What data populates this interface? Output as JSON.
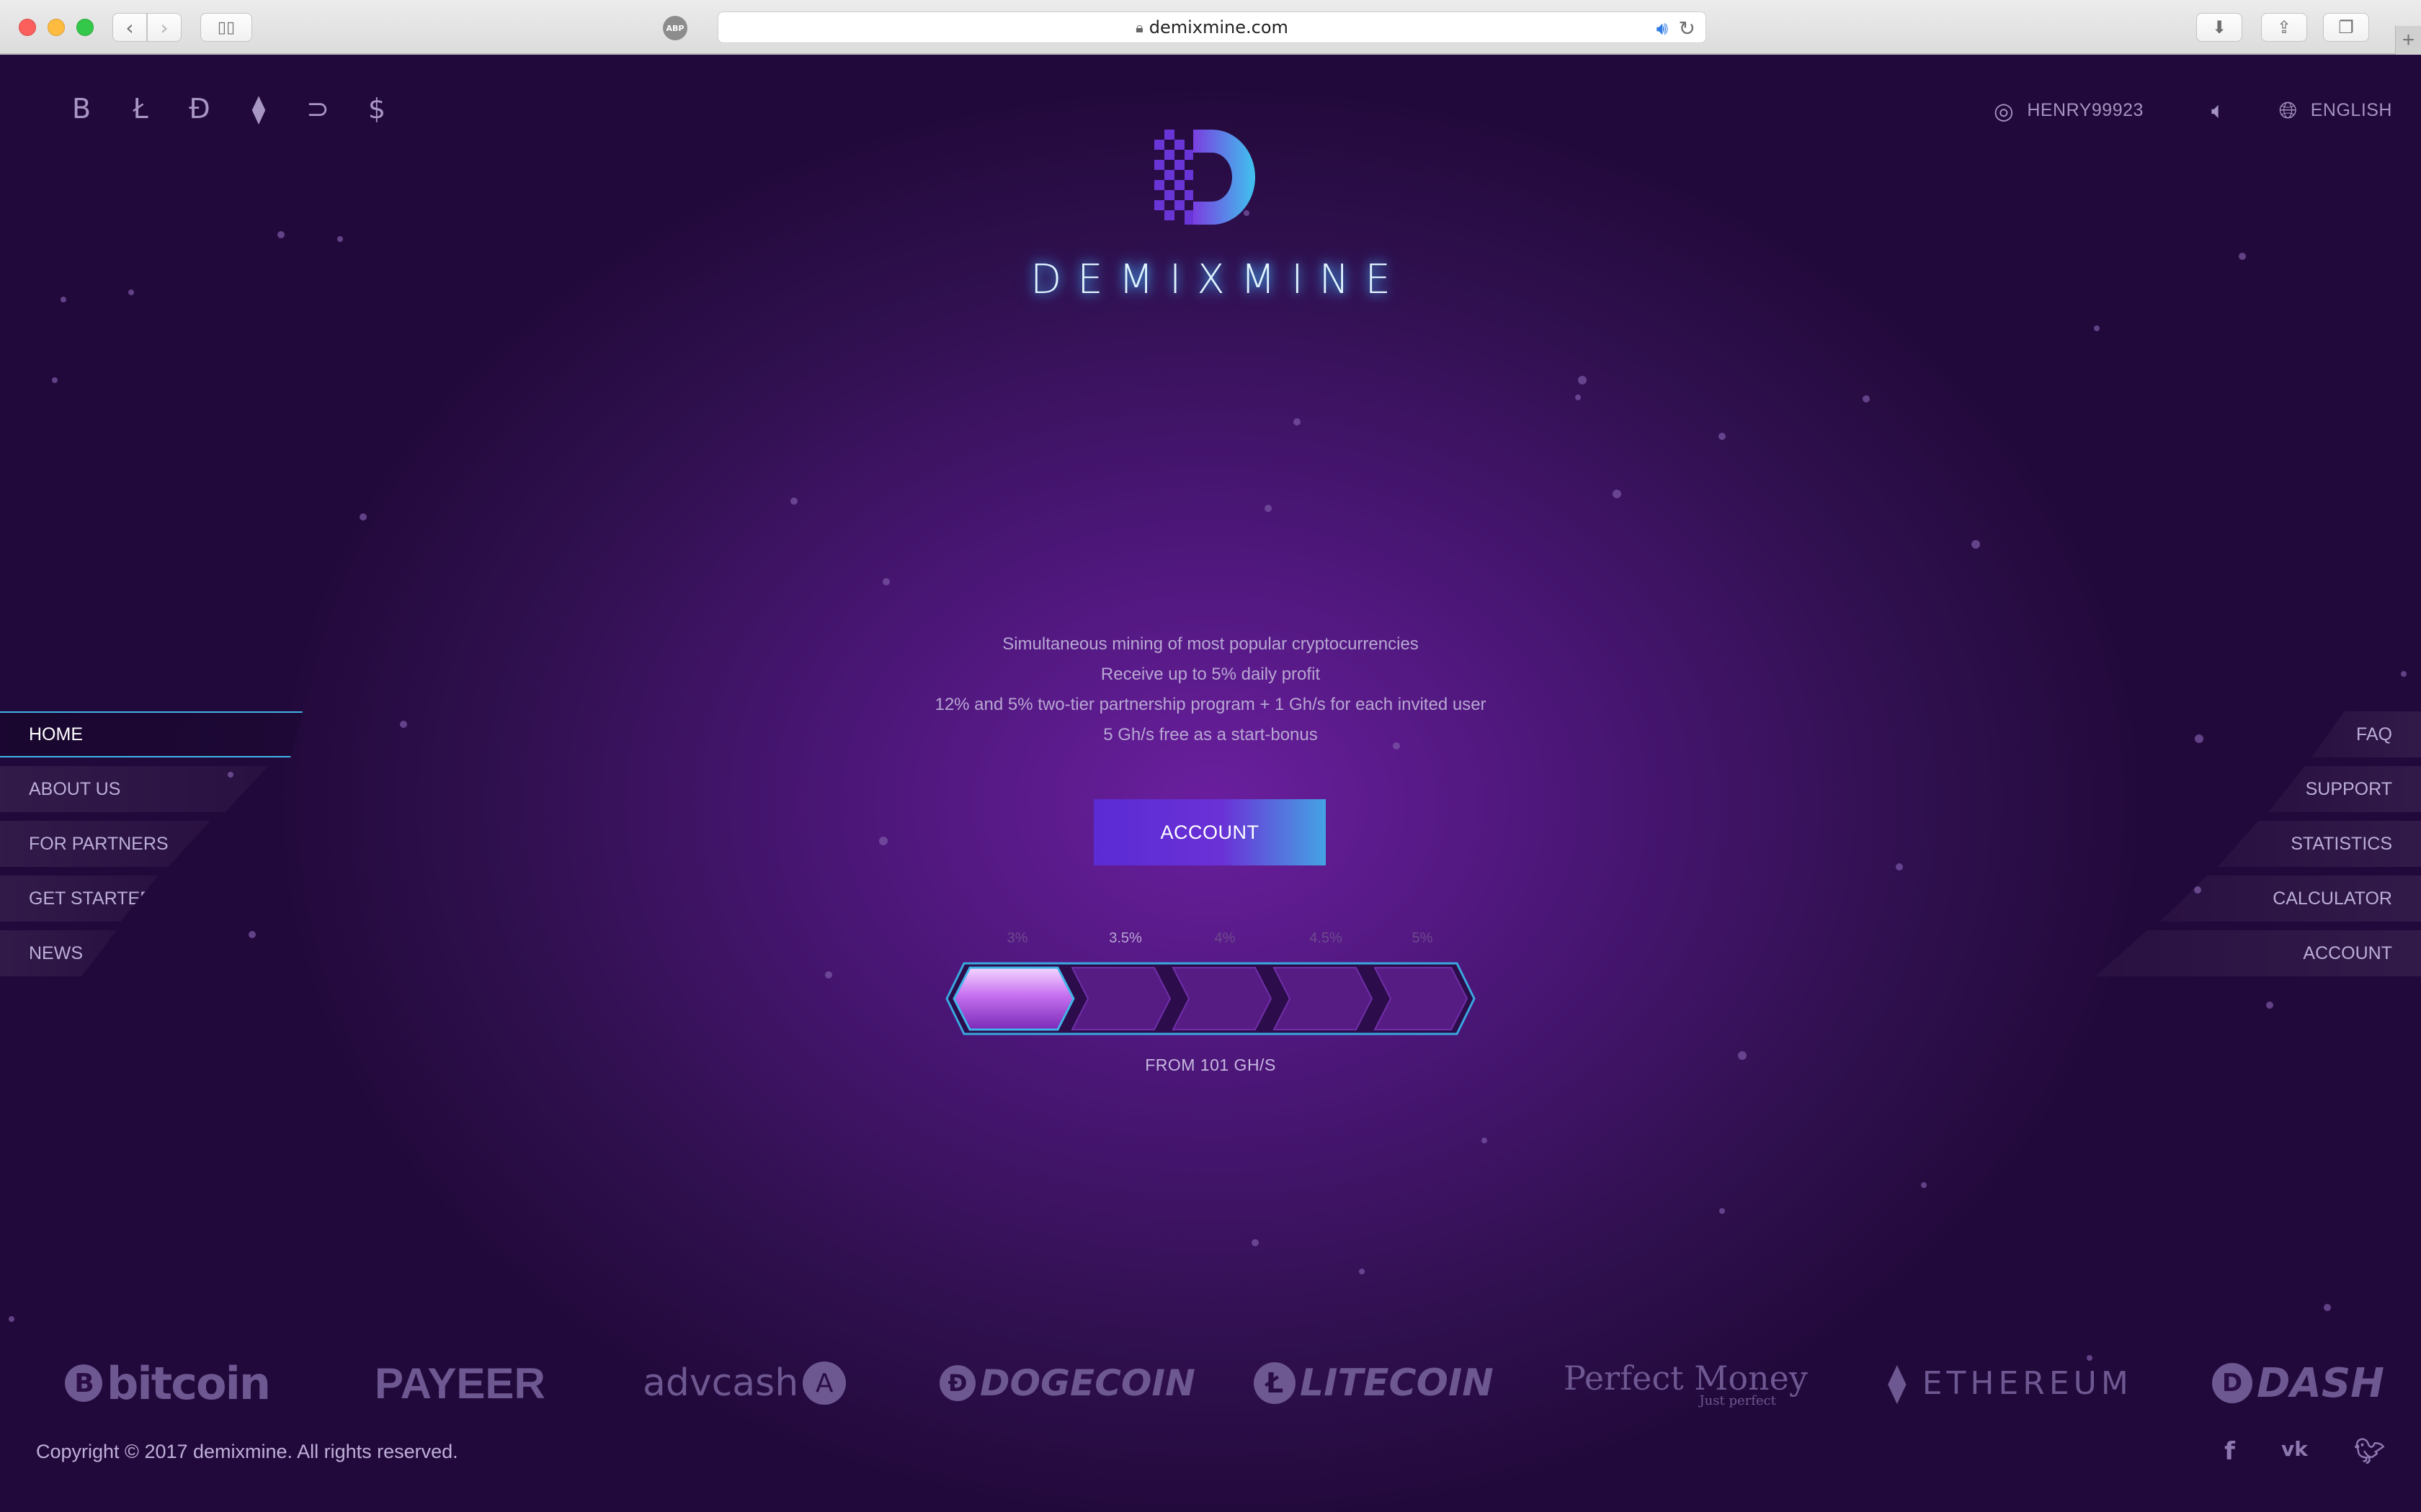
{
  "browser": {
    "url": "demixmine.com",
    "abp_label": "ABP"
  },
  "header": {
    "username": "HENRY99923",
    "language": "ENGLISH",
    "brand": "DEMIXMINE"
  },
  "coin_icons": [
    {
      "name": "bitcoin-icon",
      "glyph": "B"
    },
    {
      "name": "litecoin-icon",
      "glyph": "Ł"
    },
    {
      "name": "dogecoin-icon",
      "glyph": "Đ"
    },
    {
      "name": "ethereum-icon",
      "glyph": "⧫"
    },
    {
      "name": "dash-icon",
      "glyph": "⊃"
    },
    {
      "name": "dollar-icon",
      "glyph": "$"
    }
  ],
  "features": [
    "Simultaneous mining of most popular cryptocurrencies",
    "Receive up to 5% daily profit",
    "12% and 5% two-tier partnership program + 1 Gh/s for each invited user",
    "5 Gh/s free as a start-bonus"
  ],
  "account_button": "ACCOUNT",
  "levels": {
    "percents": [
      "3%",
      "3.5%",
      "4%",
      "4.5%",
      "5%"
    ],
    "active_index": 0,
    "selected_percent": "3.5%",
    "from_label": "FROM 101 GH/S"
  },
  "nav_left": [
    {
      "label": "HOME",
      "active": true
    },
    {
      "label": "ABOUT US",
      "active": false
    },
    {
      "label": "FOR PARTNERS",
      "active": false
    },
    {
      "label": "GET STARTED",
      "active": false
    },
    {
      "label": "NEWS",
      "active": false
    }
  ],
  "nav_right": [
    {
      "label": "FAQ"
    },
    {
      "label": "SUPPORT"
    },
    {
      "label": "STATISTICS"
    },
    {
      "label": "CALCULATOR"
    },
    {
      "label": "ACCOUNT"
    }
  ],
  "payments": {
    "bitcoin": "bitcoin",
    "payeer": "PAYEER",
    "advcash": "advcash",
    "dogecoin": "DOGECOIN",
    "litecoin": "LITECOIN",
    "perfect_money": "Perfect Money",
    "perfect_money_tag": "Just perfect",
    "ethereum": "ETHEREUM",
    "dash": "DASH"
  },
  "footer": {
    "copyright": "Copyright © 2017 demixmine. All rights reserved."
  },
  "colors": {
    "accent": "#3fb5e8",
    "brand_purple": "#5b2bd4",
    "background": "#4a1676"
  }
}
